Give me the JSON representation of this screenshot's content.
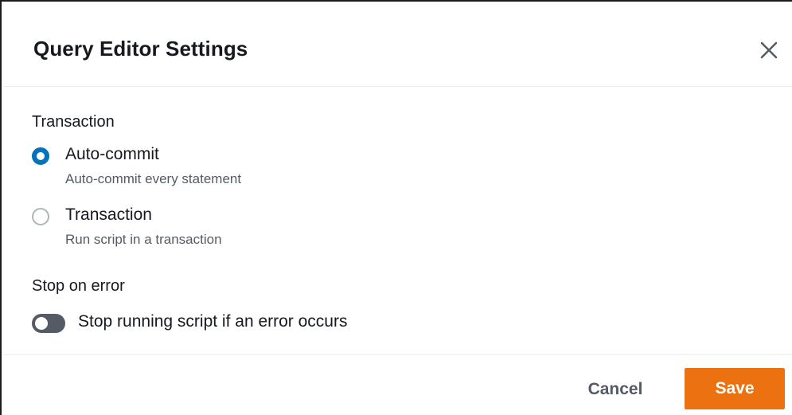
{
  "dialog": {
    "title": "Query Editor Settings",
    "close_icon": "close-icon"
  },
  "transaction": {
    "label": "Transaction",
    "options": [
      {
        "label": "Auto-commit",
        "description": "Auto-commit every statement",
        "selected": true
      },
      {
        "label": "Transaction",
        "description": "Run script in a transaction",
        "selected": false
      }
    ]
  },
  "stop_on_error": {
    "label": "Stop on error",
    "toggle_label": "Stop running script if an error occurs",
    "enabled": false
  },
  "footer": {
    "cancel_label": "Cancel",
    "save_label": "Save"
  },
  "colors": {
    "primary_button": "#ec7211",
    "radio_selected": "#0073bb",
    "toggle_off": "#545b64"
  }
}
